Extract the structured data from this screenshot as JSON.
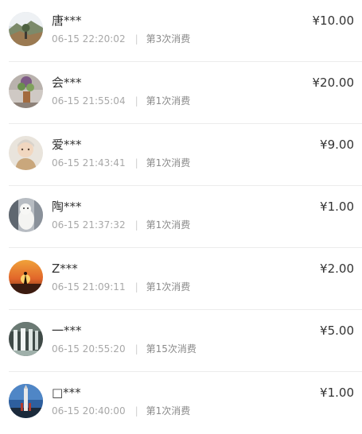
{
  "records": [
    {
      "name": "唐***",
      "time": "06-15 22:20:02",
      "count": "第3次消费",
      "amount": "¥10.00",
      "avatar": "mountain-landscape-photo"
    },
    {
      "name": "会***",
      "time": "06-15 21:55:04",
      "count": "第1次消费",
      "amount": "¥20.00",
      "avatar": "flower-pot-photo"
    },
    {
      "name": "爱***",
      "time": "06-15 21:43:41",
      "count": "第1次消费",
      "amount": "¥9.00",
      "avatar": "child-portrait-photo"
    },
    {
      "name": "陶***",
      "time": "06-15 21:37:32",
      "count": "第1次消费",
      "amount": "¥1.00",
      "avatar": "white-dog-photo"
    },
    {
      "name": "Z***",
      "time": "06-15 21:09:11",
      "count": "第1次消费",
      "amount": "¥2.00",
      "avatar": "sunset-silhouette-photo"
    },
    {
      "name": "一***",
      "time": "06-15 20:55:20",
      "count": "第15次消费",
      "amount": "¥5.00",
      "avatar": "waterfall-photo"
    },
    {
      "name": "□***",
      "time": "06-15 20:40:00",
      "count": "第1次消费",
      "amount": "¥1.00",
      "avatar": "rocket-tower-photo"
    }
  ]
}
